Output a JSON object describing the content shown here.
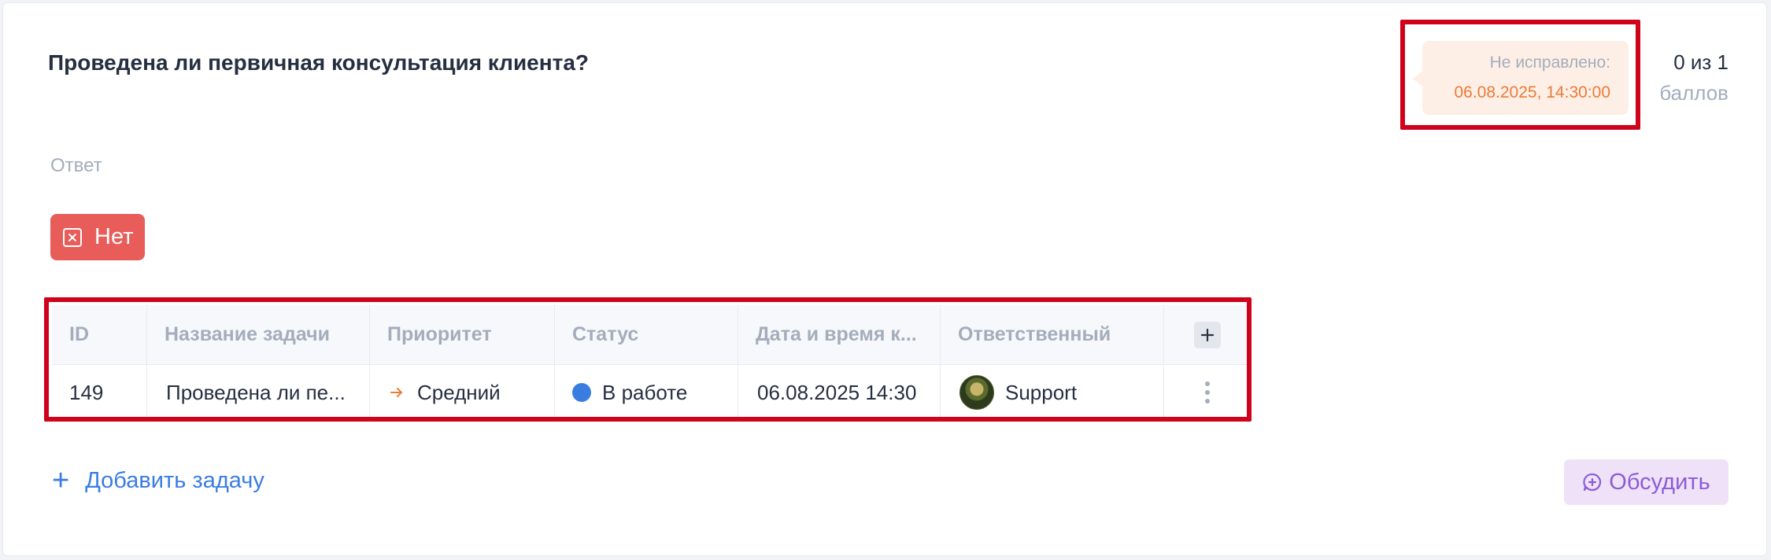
{
  "question": {
    "title": "Проведена ли первичная консультация клиента?"
  },
  "deadline": {
    "label": "Не исправлено:",
    "date": "06.08.2025, 14:30:00"
  },
  "score": {
    "value": "0 из 1",
    "unit": "баллов"
  },
  "answer": {
    "label": "Ответ",
    "value": "Нет",
    "icon": "close-box-icon"
  },
  "tasks_table": {
    "columns": [
      "ID",
      "Название задачи",
      "Приоритет",
      "Статус",
      "Дата и время к...",
      "Ответственный"
    ],
    "add_column_icon": "plus-icon",
    "rows": [
      {
        "id": "149",
        "name": "Проведена ли пе...",
        "priority": "Средний",
        "priority_icon": "arrow-right-icon",
        "status": "В работе",
        "status_color": "#3a7de0",
        "datetime": "06.08.2025 14:30",
        "assignee": "Support",
        "menu_icon": "kebab-menu-icon"
      }
    ]
  },
  "actions": {
    "add_task": "Добавить задачу",
    "discuss": "Обсудить"
  },
  "colors": {
    "accent_blue": "#3a7de0",
    "answer_red": "#e85d5a",
    "deadline_orange": "#ec7a38",
    "discuss_purple": "#8b5cd6",
    "highlight_red": "#d0021b"
  }
}
